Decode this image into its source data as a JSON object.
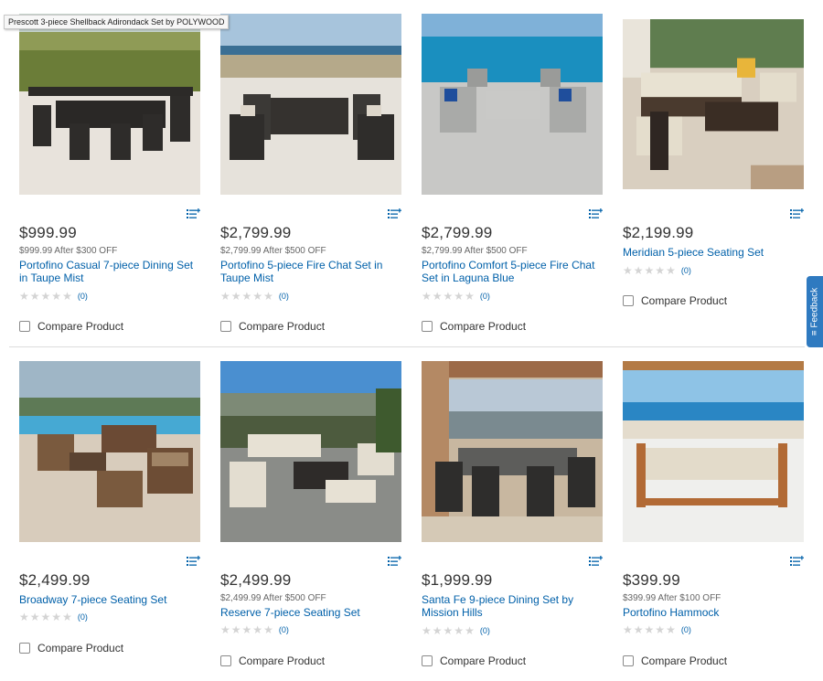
{
  "tooltip": "Prescott 3-piece Shellback Adirondack Set by POLYWOOD",
  "feedback_label": "≡ Feedback",
  "compare_label": "Compare Product",
  "colors": {
    "link": "#0060a9",
    "price": "#333333",
    "feedback_bg": "#2f7ac0",
    "star_empty": "#d4d4d4"
  },
  "products": [
    {
      "price": "$999.99",
      "promo": "$999.99 After $300 OFF",
      "name": "Portofino Casual 7-piece Dining Set in Taupe Mist",
      "reviews": "(0)",
      "image": "dining-set-grassland"
    },
    {
      "price": "$2,799.99",
      "promo": "$2,799.99 After $500 OFF",
      "name": "Portofino 5-piece Fire Chat Set in Taupe Mist",
      "reviews": "(0)",
      "image": "fire-chat-set-grassland"
    },
    {
      "price": "$2,799.99",
      "promo": "$2,799.99 After $500 OFF",
      "name": "Portofino Comfort 5-piece Fire Chat Set in Laguna Blue",
      "reviews": "(0)",
      "image": "fire-chat-set-ocean"
    },
    {
      "price": "$2,199.99",
      "promo": "",
      "name": "Meridian 5-piece Seating Set",
      "reviews": "(0)",
      "image": "seating-set-patio"
    },
    {
      "price": "$2,499.99",
      "promo": "",
      "name": "Broadway 7-piece Seating Set",
      "reviews": "(0)",
      "image": "seating-set-poolside"
    },
    {
      "price": "$2,499.99",
      "promo": "$2,499.99 After $500 OFF",
      "name": "Reserve 7-piece Seating Set",
      "reviews": "(0)",
      "image": "seating-set-hillside"
    },
    {
      "price": "$1,999.99",
      "promo": "",
      "name": "Santa Fe 9-piece Dining Set by Mission Hills",
      "reviews": "(0)",
      "image": "dining-set-terrace"
    },
    {
      "price": "$399.99",
      "promo": "$399.99 After $100 OFF",
      "name": "Portofino Hammock",
      "reviews": "(0)",
      "image": "hammock-beach"
    }
  ]
}
